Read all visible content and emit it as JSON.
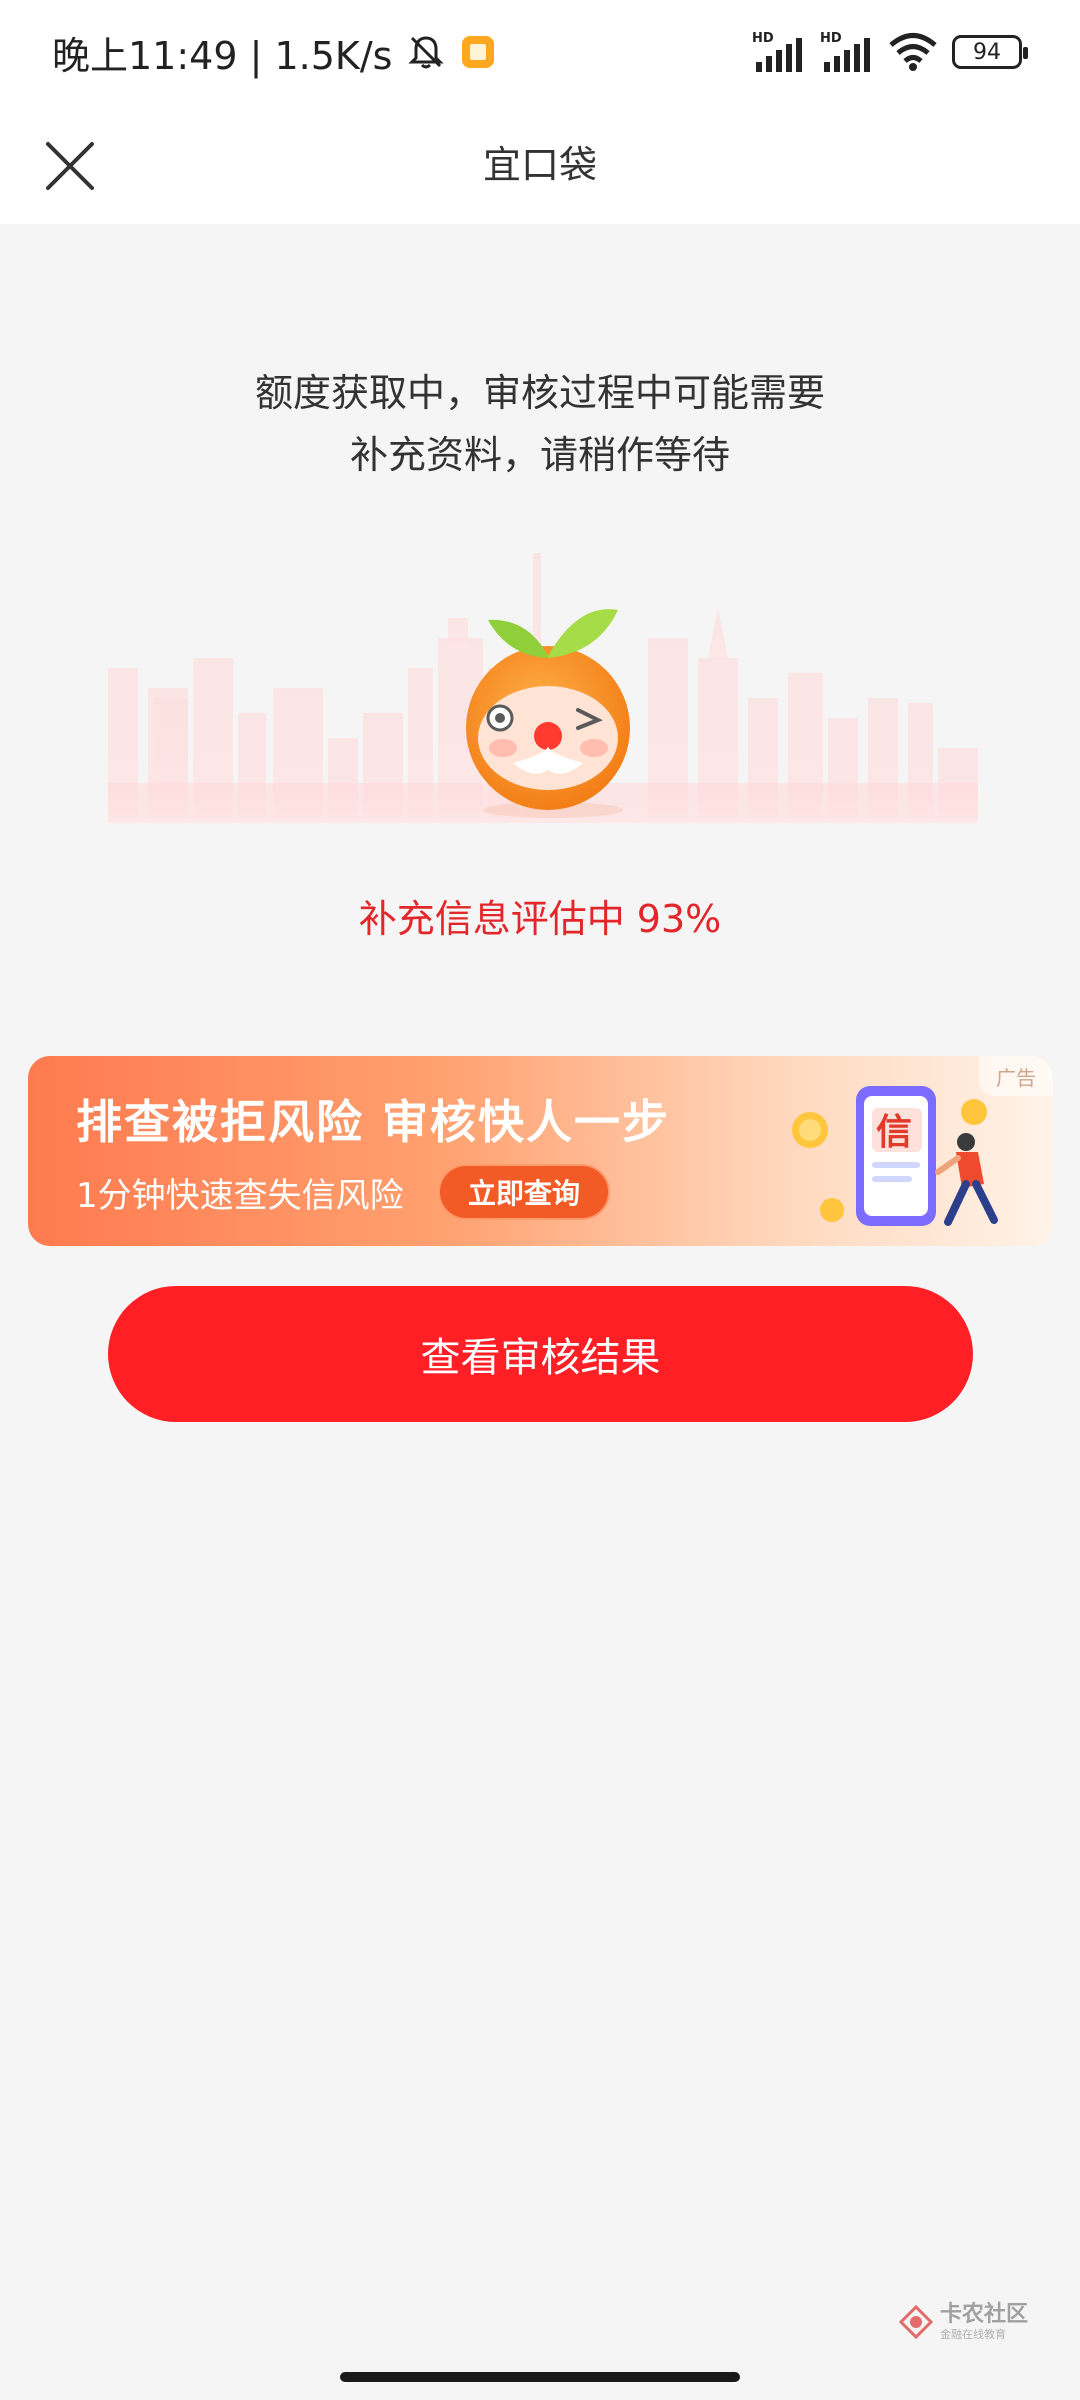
{
  "status_bar": {
    "time": "晚上11:49 | 1.5K/s",
    "battery": "94",
    "icons": [
      "bell-muted-icon",
      "app-notification-icon",
      "signal-hd-icon",
      "wifi-icon",
      "battery-icon"
    ]
  },
  "navbar": {
    "title": "宜口袋",
    "close_icon": "close-icon"
  },
  "main": {
    "headline_line1": "额度获取中，审核过程中可能需要",
    "headline_line2": "补充资料，请稍作等待",
    "progress_text": "补充信息评估中 93%",
    "progress_value": 93
  },
  "ad": {
    "title": "排查被拒风险  审核快人一步",
    "subtitle": "1分钟快速查失信风险",
    "cta": "立即查询",
    "tag": "广告",
    "art_glyph": "信"
  },
  "primary_button": {
    "label": "查看审核结果"
  },
  "watermark": {
    "main": "卡农社区",
    "sub": "金融在线教育"
  },
  "colors": {
    "accent_red": "#ff1f25",
    "progress_red": "#e2262a",
    "ad_orange": "#ff7a4f"
  }
}
